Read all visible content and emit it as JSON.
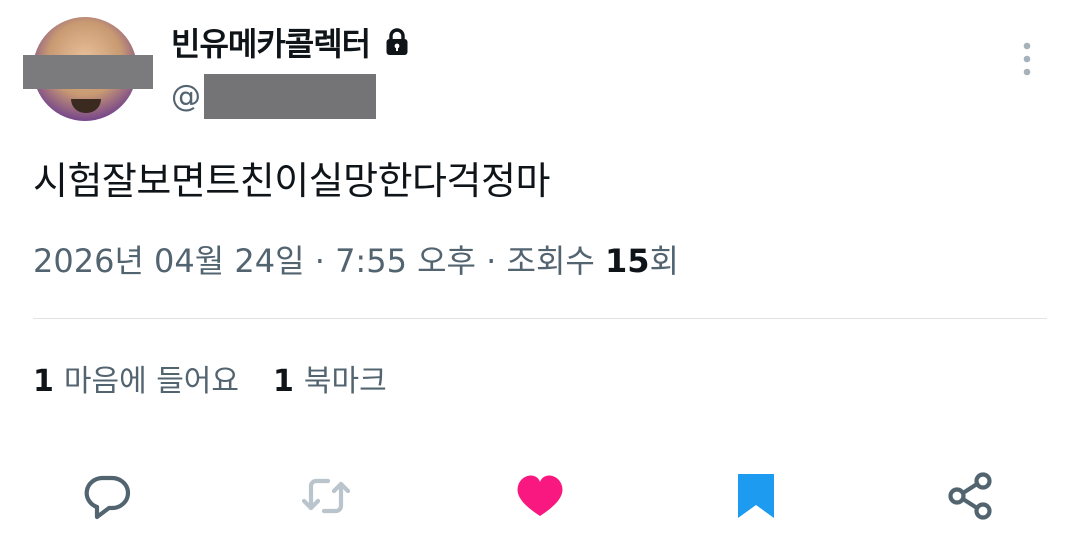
{
  "tweet": {
    "display_name": "빈유메카콜렉터",
    "handle_prefix": "@",
    "text": "시험잘보면트친이실망한다걱정마",
    "date": "2026년 04월 24일",
    "sep1": " · ",
    "time": "7:55 오후",
    "sep2": " · ",
    "views_label": "조회수 ",
    "views_count": "15",
    "views_suffix": "회"
  },
  "stats": {
    "likes_count": "1",
    "likes_label": "마음에 들어요",
    "bookmarks_count": "1",
    "bookmarks_label": "북마크"
  },
  "icons": {
    "lock": "lock-icon",
    "more": "more-vertical-icon",
    "reply": "reply-icon",
    "retweet": "retweet-icon",
    "like": "heart-icon",
    "bookmark": "bookmark-icon",
    "share": "share-icon"
  },
  "colors": {
    "text_primary": "#0f1419",
    "text_secondary": "#536471",
    "like_active": "#f91880",
    "bookmark_active": "#1d9bf0",
    "retweet_disabled": "#b9c4cc"
  }
}
